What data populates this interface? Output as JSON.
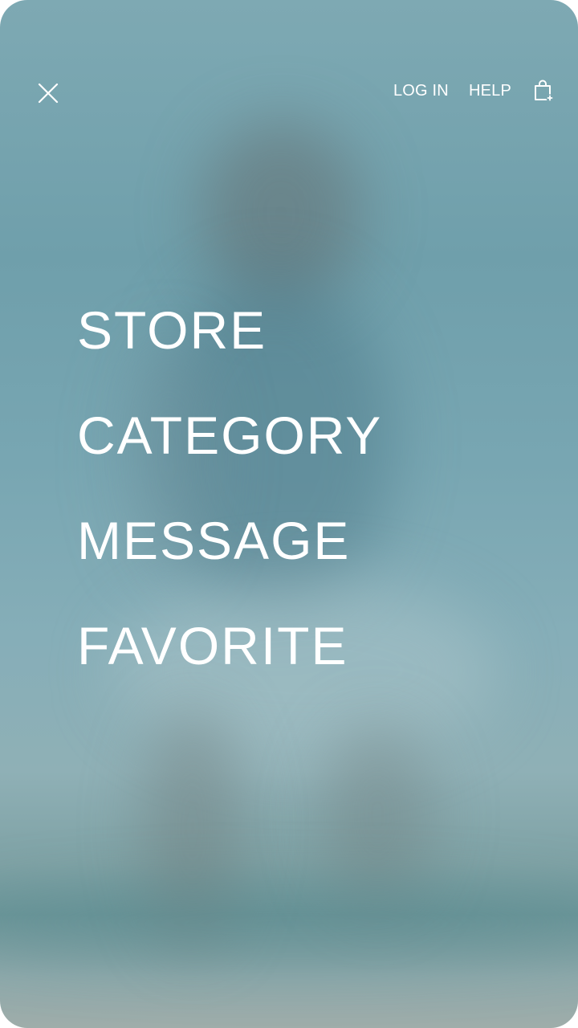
{
  "header": {
    "close_icon": "close-icon",
    "login_label": "LOG IN",
    "help_label": "HELP",
    "bag_icon": "shopping-bag-icon"
  },
  "menu": {
    "items": [
      {
        "label": "STORE"
      },
      {
        "label": "CATEGORY"
      },
      {
        "label": "MESSAGE"
      },
      {
        "label": "FAVORITE"
      }
    ]
  },
  "colors": {
    "background": "#78a6b2",
    "text": "#ffffff"
  }
}
